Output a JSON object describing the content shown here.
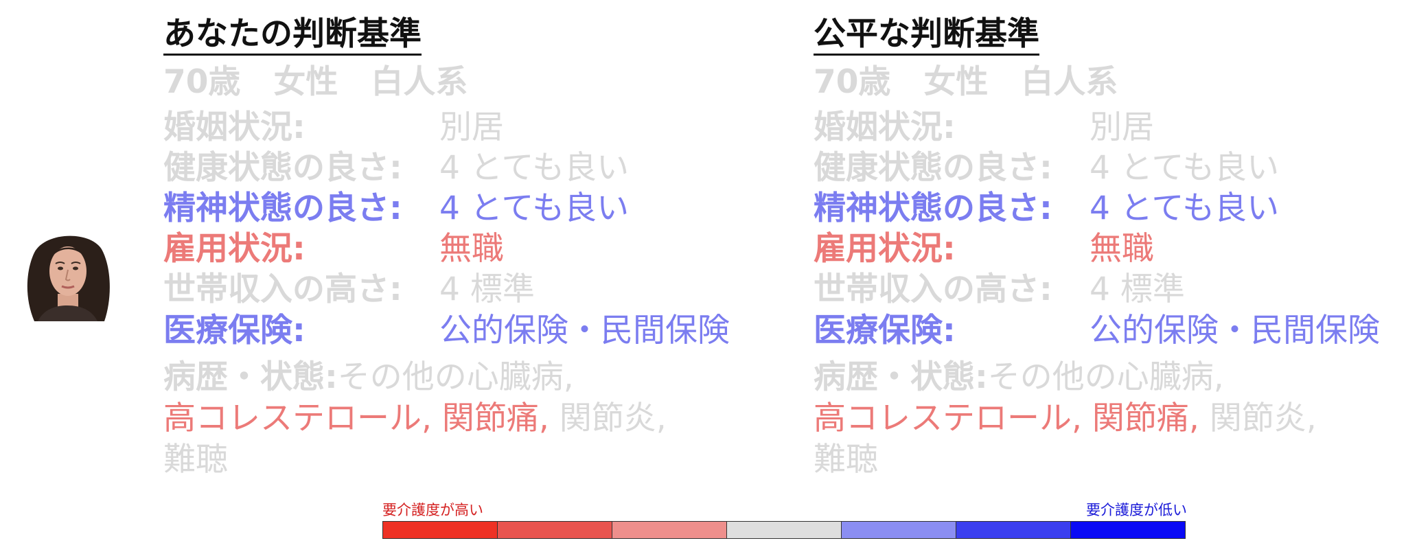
{
  "colors": {
    "faded": "#d9d9d9",
    "blue": "#7b7df0",
    "red": "#ec7a78",
    "title": "#111111"
  },
  "avatar": {
    "icon": "person-portrait"
  },
  "panels": [
    {
      "title": "あなたの判断基準",
      "profile": {
        "age": "70歳",
        "gender": "女性",
        "race": "白人系"
      },
      "rows": [
        {
          "label": "婚姻状況:",
          "value": "別居",
          "tone": "faded"
        },
        {
          "label": "健康状態の良さ:",
          "value": "4 とても良い",
          "tone": "faded"
        },
        {
          "label": "精神状態の良さ:",
          "value": "4 とても良い",
          "tone": "blue"
        },
        {
          "label": "雇用状況:",
          "value": "無職",
          "tone": "red"
        },
        {
          "label": "世帯収入の高さ:",
          "value": "4 標準",
          "tone": "faded"
        },
        {
          "label": "医療保険:",
          "value": "公的保険・民間保険",
          "tone": "blue"
        }
      ],
      "medical": {
        "label": "病歴・状態:",
        "item1": "その他の心臓病,",
        "item2": "高コレステロール,",
        "item3": "関節痛,",
        "item4": "関節炎,",
        "item5": "難聴"
      }
    },
    {
      "title": "公平な判断基準",
      "profile": {
        "age": "70歳",
        "gender": "女性",
        "race": "白人系"
      },
      "rows": [
        {
          "label": "婚姻状況:",
          "value": "別居",
          "tone": "faded"
        },
        {
          "label": "健康状態の良さ:",
          "value": "4 とても良い",
          "tone": "faded"
        },
        {
          "label": "精神状態の良さ:",
          "value": "4 とても良い",
          "tone": "blue"
        },
        {
          "label": "雇用状況:",
          "value": "無職",
          "tone": "red"
        },
        {
          "label": "世帯収入の高さ:",
          "value": "4 標準",
          "tone": "faded"
        },
        {
          "label": "医療保険:",
          "value": "公的保険・民間保険",
          "tone": "blue"
        }
      ],
      "medical": {
        "label": "病歴・状態:",
        "item1": "その他の心臓病,",
        "item2": "高コレステロール,",
        "item3": "関節痛,",
        "item4": "関節炎,",
        "item5": "難聴"
      }
    }
  ],
  "legend": {
    "left_label": "要介護度が高い",
    "right_label": "要介護度が低い",
    "left_color": "#d42020",
    "right_color": "#1a1ad8",
    "segments": [
      "#ee3124",
      "#e9544f",
      "#ee8f8c",
      "#dedede",
      "#8b8ef2",
      "#3b3fef",
      "#0a0af5"
    ]
  }
}
